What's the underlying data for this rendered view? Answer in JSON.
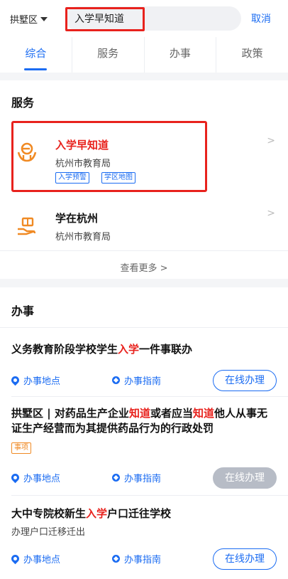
{
  "header": {
    "district": "拱墅区",
    "search_value": "入学早知道",
    "cancel_label": "取消"
  },
  "tabs": [
    "综合",
    "服务",
    "办事",
    "政策"
  ],
  "active_tab": 0,
  "services": {
    "section_title": "服务",
    "items": [
      {
        "title": "入学早知道",
        "org": "杭州市教育局",
        "tags": [
          "入学预警",
          "学区地图"
        ],
        "icon": "school-entry-icon"
      },
      {
        "title": "学在杭州",
        "org": "杭州市教育局",
        "tags": [],
        "icon": "book-hand-icon"
      }
    ],
    "more_label": "查看更多 >"
  },
  "affairs": {
    "section_title": "办事",
    "items": [
      {
        "title_parts": [
          "义务教育阶段学校学生",
          "入学",
          "一件事联办"
        ],
        "location_label": "办事地点",
        "guide_label": "办事指南",
        "online_label": "在线办理",
        "online_enabled": true
      },
      {
        "title_parts": [
          "拱墅区 | 对药品生产企业",
          "知道",
          "或者应当",
          "知道",
          "他人从事无证生产经营而为其提供药品行为的行政处罚"
        ],
        "badge": "事项",
        "location_label": "办事地点",
        "guide_label": "办事指南",
        "online_label": "在线办理",
        "online_enabled": false
      },
      {
        "title_parts": [
          "大中专院校新生",
          "入学",
          "户口迁往学校"
        ],
        "subtitle": "办理户口迁移迁出",
        "location_label": "办事地点",
        "guide_label": "办事指南",
        "online_label": "在线办理",
        "online_enabled": true
      }
    ]
  },
  "colors": {
    "accent": "#1b6cf2",
    "highlight": "#e8221d",
    "icon_orange": "#f08a24",
    "disabled": "#b7bcc6"
  }
}
